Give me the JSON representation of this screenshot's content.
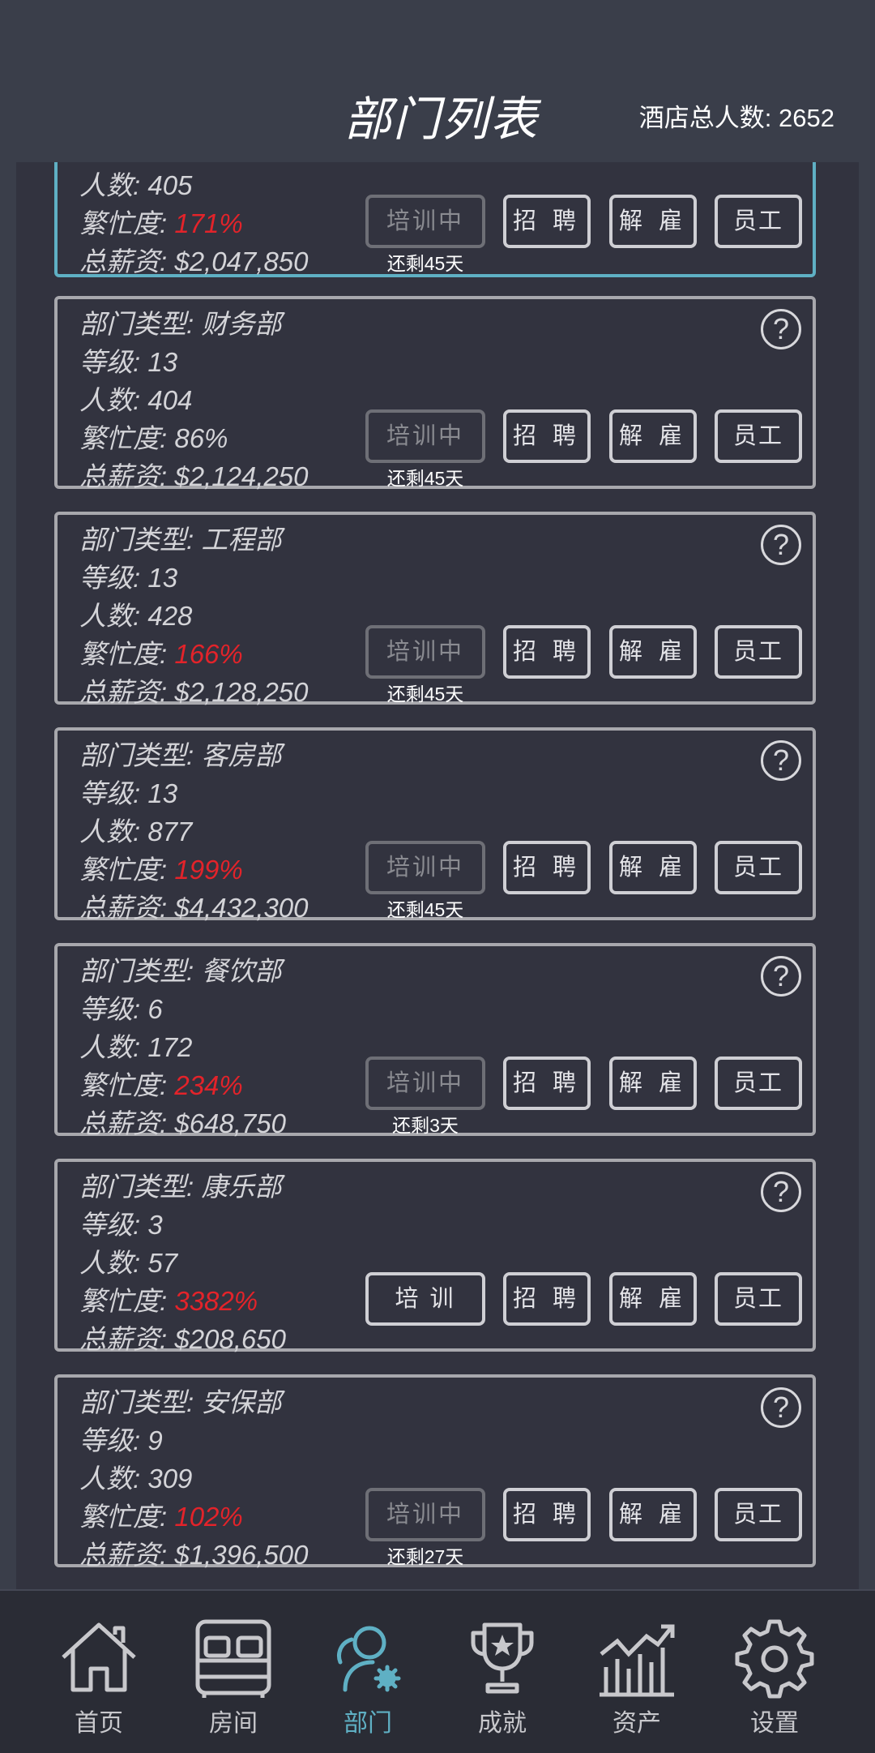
{
  "header": {
    "title": "部门列表",
    "total_label": "酒店总人数: 2652"
  },
  "first_card": {
    "count": "人数: 405",
    "busy_label": "繁忙度: ",
    "busy_value": "171%",
    "salary": "总薪资: $2,047,850",
    "train": "培训中",
    "recruit": "招 聘",
    "fire": "解 雇",
    "staff": "员工",
    "remain": "还剩45天"
  },
  "cards": [
    {
      "type": "部门类型: 财务部",
      "level": "等级: 13",
      "count": "人数: 404",
      "busy_label": "繁忙度: 86%",
      "busy_value": "",
      "salary": "总薪资: $2,124,250",
      "train": "培训中",
      "recruit": "招 聘",
      "fire": "解 雇",
      "staff": "员工",
      "remain": "还剩45天"
    },
    {
      "type": "部门类型: 工程部",
      "level": "等级: 13",
      "count": "人数: 428",
      "busy_label": "繁忙度: ",
      "busy_value": "166%",
      "salary": "总薪资: $2,128,250",
      "train": "培训中",
      "recruit": "招 聘",
      "fire": "解 雇",
      "staff": "员工",
      "remain": "还剩45天"
    },
    {
      "type": "部门类型: 客房部",
      "level": "等级: 13",
      "count": "人数: 877",
      "busy_label": "繁忙度: ",
      "busy_value": "199%",
      "salary": "总薪资: $4,432,300",
      "train": "培训中",
      "recruit": "招 聘",
      "fire": "解 雇",
      "staff": "员工",
      "remain": "还剩45天"
    },
    {
      "type": "部门类型: 餐饮部",
      "level": "等级: 6",
      "count": "人数: 172",
      "busy_label": "繁忙度: ",
      "busy_value": "234%",
      "salary": "总薪资: $648,750",
      "train": "培训中",
      "recruit": "招 聘",
      "fire": "解 雇",
      "staff": "员工",
      "remain": "还剩3天"
    },
    {
      "type": "部门类型: 康乐部",
      "level": "等级: 3",
      "count": "人数: 57",
      "busy_label": "繁忙度: ",
      "busy_value": "3382%",
      "salary": "总薪资: $208,650",
      "train": "培 训",
      "recruit": "招 聘",
      "fire": "解 雇",
      "staff": "员工",
      "remain": ""
    },
    {
      "type": "部门类型: 安保部",
      "level": "等级: 9",
      "count": "人数: 309",
      "busy_label": "繁忙度: ",
      "busy_value": "102%",
      "salary": "总薪资: $1,396,500",
      "train": "培训中",
      "recruit": "招 聘",
      "fire": "解 雇",
      "staff": "员工",
      "remain": "还剩27天"
    }
  ],
  "help_glyph": "?",
  "nav": [
    {
      "label": "首页",
      "icon": "home-icon"
    },
    {
      "label": "房间",
      "icon": "bed-icon"
    },
    {
      "label": "部门",
      "icon": "department-icon"
    },
    {
      "label": "成就",
      "icon": "trophy-icon"
    },
    {
      "label": "资产",
      "icon": "chart-icon"
    },
    {
      "label": "设置",
      "icon": "gear-icon"
    }
  ],
  "colors": {
    "accent": "#5fb0c4",
    "busy_red": "#e3232a"
  }
}
